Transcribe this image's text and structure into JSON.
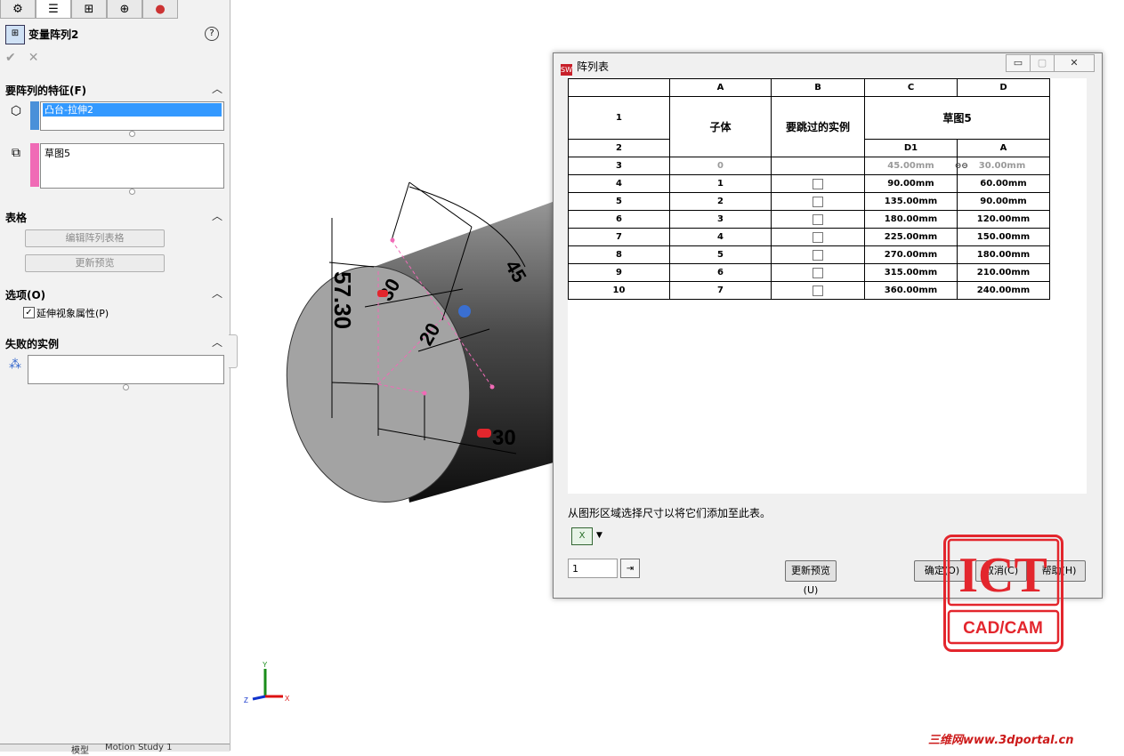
{
  "property_manager": {
    "tabs": [
      "feature-manager-icon",
      "property-manager-icon",
      "configuration-manager-icon",
      "dimxpert-icon",
      "display-manager-icon"
    ],
    "title": "变量阵列2",
    "section_features": {
      "title": "要阵列的特征(F)",
      "items": [
        "凸台-拉伸2"
      ],
      "sketch_items": [
        "草图5"
      ]
    },
    "section_table": {
      "title": "表格",
      "edit_button": "编辑阵列表格",
      "preview_button": "更新预览"
    },
    "section_options": {
      "title": "选项(O)",
      "extend_visual_label": "延伸视象属性(P)",
      "extend_visual_checked": true
    },
    "section_failed": {
      "title": "失败的实例"
    },
    "bottom_tabs": [
      "模型",
      "Motion Study 1"
    ]
  },
  "viewport": {
    "dimensions": [
      "57.30",
      "30",
      "20",
      "45",
      "30"
    ],
    "triad": {
      "x": "X",
      "y": "Y",
      "z": "Z"
    }
  },
  "dialog": {
    "title": "阵列表",
    "columns": [
      "A",
      "B",
      "C",
      "D"
    ],
    "row_labels": [
      "1",
      "2",
      "3",
      "4",
      "5",
      "6",
      "7",
      "8",
      "9",
      "10"
    ],
    "header": {
      "col_a": "子体",
      "col_b": "要跳过的实例",
      "sketch": "草图5",
      "c_name": "D1",
      "d_name": "A"
    },
    "rows": [
      {
        "index": "0",
        "d1": "45.00mm",
        "a": "30.00mm",
        "skip": false,
        "base": true
      },
      {
        "index": "1",
        "d1": "90.00mm",
        "a": "60.00mm",
        "skip": false
      },
      {
        "index": "2",
        "d1": "135.00mm",
        "a": "90.00mm",
        "skip": false
      },
      {
        "index": "3",
        "d1": "180.00mm",
        "a": "120.00mm",
        "skip": false
      },
      {
        "index": "4",
        "d1": "225.00mm",
        "a": "150.00mm",
        "skip": false
      },
      {
        "index": "5",
        "d1": "270.00mm",
        "a": "180.00mm",
        "skip": false
      },
      {
        "index": "6",
        "d1": "315.00mm",
        "a": "210.00mm",
        "skip": false
      },
      {
        "index": "7",
        "d1": "360.00mm",
        "a": "240.00mm",
        "skip": false
      }
    ],
    "hint": "从图形区域选择尺寸以将它们添加至此表。",
    "instance_count": "1",
    "buttons": {
      "update_preview": "更新预览(U)",
      "ok": "确定(O)",
      "cancel": "取消(C)",
      "help": "帮助(H)"
    }
  },
  "logo": {
    "top": "ICT",
    "bottom": "CAD/CAM"
  },
  "watermark": "三维网www.3dportal.cn",
  "colors": {
    "accent_red": "#e3262d",
    "selection_blue": "#3399ff",
    "feature_bar_blue": "#4a90d9",
    "sketch_bar_pink": "#f06bb6"
  }
}
